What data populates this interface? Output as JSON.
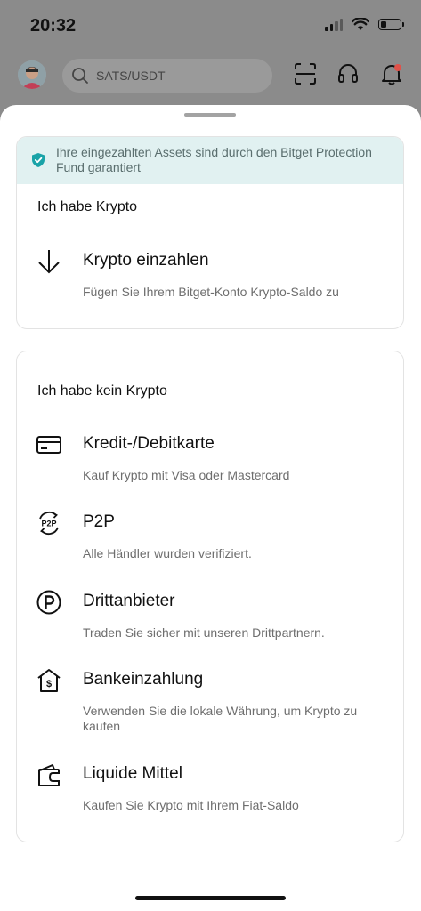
{
  "status_bar": {
    "time": "20:32",
    "battery_level": 0.3
  },
  "header": {
    "search_placeholder": "SATS/USDT",
    "notification_dot_color": "#e0524a"
  },
  "banner": {
    "text": "Ihre eingezahlten Assets sind durch den Bitget Protection Fund garantiert",
    "accent": "#1aa3a8"
  },
  "has_crypto": {
    "title": "Ich habe Krypto",
    "items": [
      {
        "icon": "arrow-down-icon",
        "title": "Krypto einzahlen",
        "desc": "Fügen Sie Ihrem Bitget-Konto Krypto-Saldo zu"
      }
    ]
  },
  "no_crypto": {
    "title": "Ich habe kein Krypto",
    "items": [
      {
        "icon": "credit-card-icon",
        "title": "Kredit-/Debitkarte",
        "desc": "Kauf Krypto mit Visa oder Mastercard"
      },
      {
        "icon": "p2p-icon",
        "title": "P2P",
        "desc": "Alle Händler wurden verifiziert.",
        "icon_text": "P2P"
      },
      {
        "icon": "third-party-icon",
        "title": "Drittanbieter",
        "desc": "Traden Sie sicher mit unseren Drittpartnern."
      },
      {
        "icon": "bank-icon",
        "title": "Bankeinzahlung",
        "desc": "Verwenden Sie die lokale Währung, um Krypto zu kaufen",
        "icon_text": "$"
      },
      {
        "icon": "wallet-icon",
        "title": "Liquide Mittel",
        "desc": "Kaufen Sie Krypto mit Ihrem Fiat-Saldo"
      }
    ]
  }
}
